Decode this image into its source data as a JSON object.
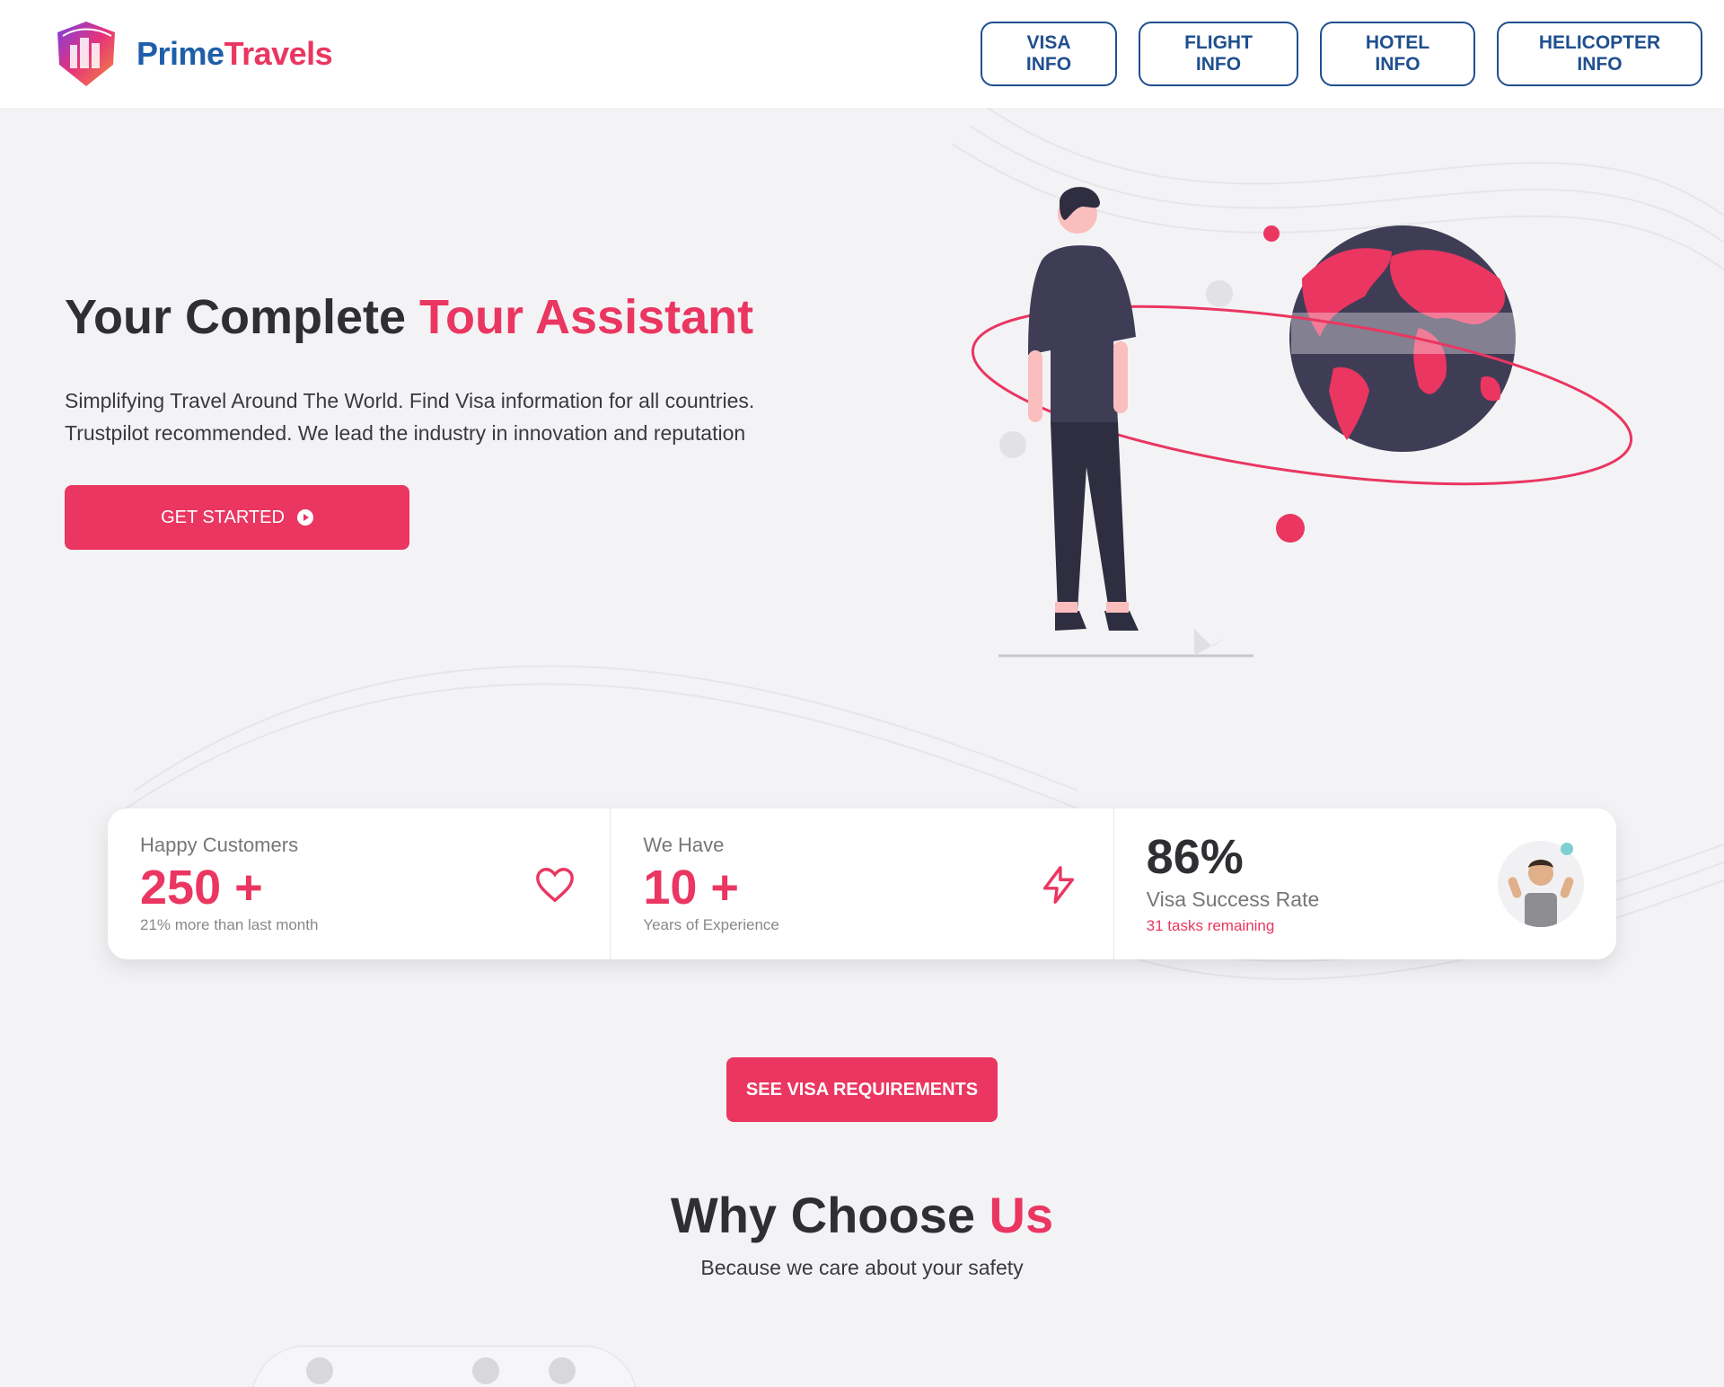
{
  "brand": {
    "name_part1": "Prime",
    "name_part2": "Travels"
  },
  "nav": [
    {
      "label": "VISA INFO"
    },
    {
      "label": "FLIGHT INFO"
    },
    {
      "label": "HOTEL INFO"
    },
    {
      "label": "HELICOPTER INFO"
    }
  ],
  "hero": {
    "title_main": "Your Complete ",
    "title_accent": "Tour Assistant",
    "subtitle_line1": "Simplifying Travel Around The World. Find Visa information for all countries.",
    "subtitle_line2": "Trustpilot recommended. We lead the industry in innovation and reputation",
    "cta_label": "GET STARTED"
  },
  "stats": [
    {
      "label": "Happy Customers",
      "value": "250 +",
      "note": "21% more than last month",
      "icon": "heart-icon"
    },
    {
      "label": "We Have",
      "value": "10 +",
      "note": "Years of Experience",
      "icon": "lightning-icon"
    },
    {
      "value": "86%",
      "label": "Visa Success Rate",
      "note": "31 tasks remaining",
      "icon": "avatar"
    }
  ],
  "visa_button": {
    "label": "SEE VISA REQUIREMENTS"
  },
  "why": {
    "title_main": "Why Choose ",
    "title_accent": "Us",
    "subtitle": "Because we care about your safety"
  },
  "colors": {
    "accent": "#ea3661",
    "brand_blue": "#1f5faa",
    "nav_border": "#1f4f8f",
    "dark": "#2f2f33"
  }
}
